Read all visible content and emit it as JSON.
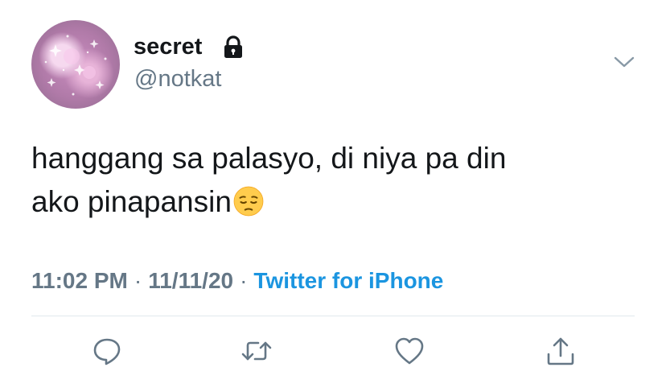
{
  "tweet": {
    "display_name": "secret",
    "handle": "@notkat",
    "protected_icon": "lock-icon",
    "text_line1": "hanggang sa palasyo, di niya pa din",
    "text_line2": "ako pinapansin",
    "emoji": "pensive-face-emoji",
    "time": "11:02 PM",
    "separator": "·",
    "date": "11/11/20",
    "source": "Twitter for iPhone"
  },
  "actions": {
    "reply_icon": "reply-icon",
    "retweet_icon": "retweet-icon",
    "like_icon": "heart-icon",
    "share_icon": "share-icon"
  },
  "colors": {
    "text": "#14171a",
    "secondary": "#657786",
    "link": "#1b95e0",
    "divider": "#e1e8ed",
    "icon": "#657786"
  }
}
